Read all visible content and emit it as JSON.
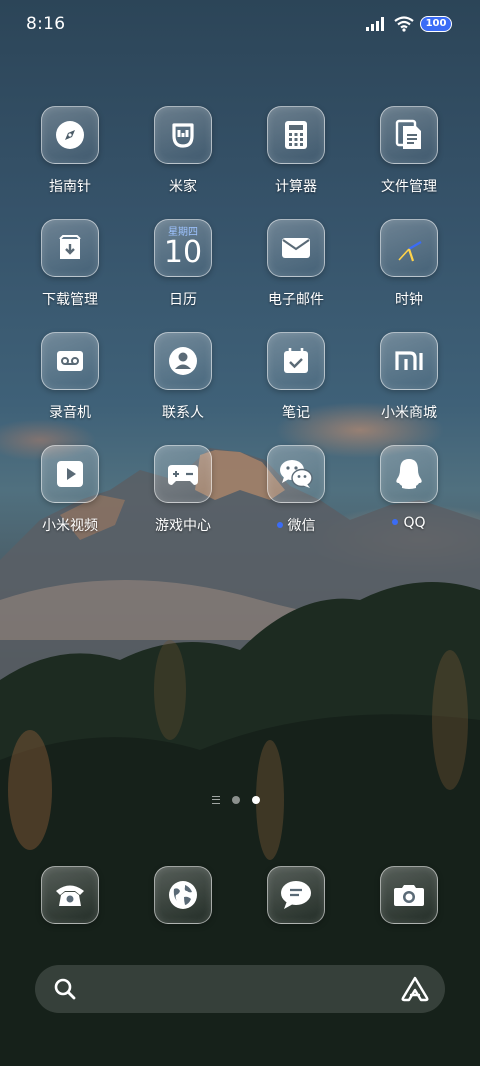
{
  "status_bar": {
    "time": "8:16",
    "battery": "100",
    "icons": [
      "signal-icon",
      "wifi-icon",
      "battery-icon"
    ]
  },
  "apps": [
    {
      "label": "指南针",
      "icon": "compass-icon"
    },
    {
      "label": "米家",
      "icon": "mijia-icon"
    },
    {
      "label": "计算器",
      "icon": "calculator-icon"
    },
    {
      "label": "文件管理",
      "icon": "file-manager-icon"
    },
    {
      "label": "下载管理",
      "icon": "download-icon"
    },
    {
      "label": "日历",
      "icon": "calendar-icon",
      "weekday": "星期四",
      "day": "10"
    },
    {
      "label": "电子邮件",
      "icon": "mail-icon"
    },
    {
      "label": "时钟",
      "icon": "clock-icon"
    },
    {
      "label": "录音机",
      "icon": "recorder-icon"
    },
    {
      "label": "联系人",
      "icon": "contacts-icon"
    },
    {
      "label": "笔记",
      "icon": "notes-icon"
    },
    {
      "label": "小米商城",
      "icon": "mi-store-icon"
    },
    {
      "label": "小米视频",
      "icon": "video-icon"
    },
    {
      "label": "游戏中心",
      "icon": "game-center-icon"
    },
    {
      "label": "微信",
      "icon": "wechat-icon",
      "new_dot": true
    },
    {
      "label": "QQ",
      "icon": "qq-icon",
      "new_dot": true
    }
  ],
  "pager": {
    "pages": 2,
    "active": 2
  },
  "dock": [
    {
      "name": "phone",
      "icon": "phone-icon"
    },
    {
      "name": "browser",
      "icon": "browser-icon"
    },
    {
      "name": "messages",
      "icon": "messages-icon"
    },
    {
      "name": "camera",
      "icon": "camera-icon"
    }
  ],
  "search": {
    "icon": "search-icon",
    "assistant_icon": "assistant-icon"
  },
  "colors": {
    "notification_dot": "#3b6cf6",
    "battery_fill": "#3b6cf6"
  }
}
